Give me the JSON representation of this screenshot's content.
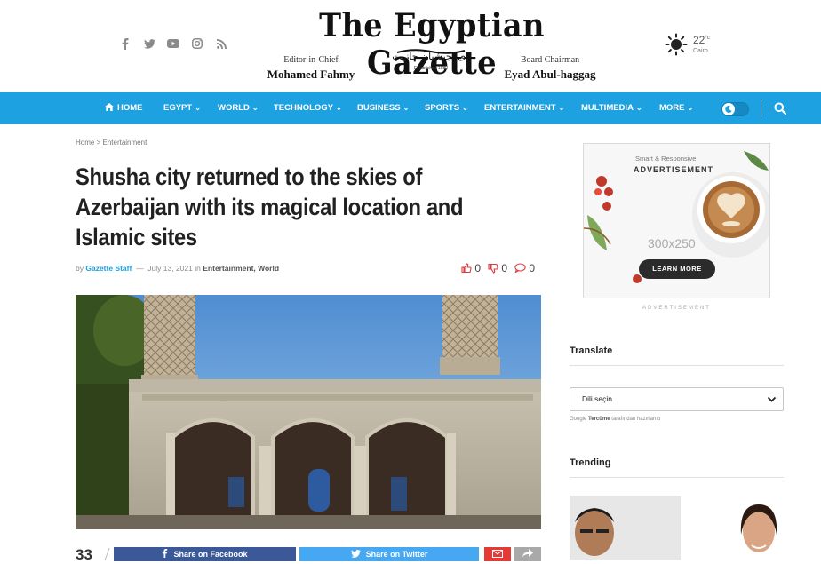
{
  "header": {
    "logo_text": "The Egyptian Gazette",
    "editor_label": "Editor-in-Chief",
    "editor_name": "Mohamed Fahmy",
    "arabic_name": "ذى اجبشيان جازيت",
    "established": "Established 1880",
    "board_label": "Board Chairman",
    "board_name": "Eyad Abul-haggag",
    "weather": {
      "temp": "22",
      "unit": "°c",
      "city": "Cairo"
    },
    "social_icons": [
      "facebook-icon",
      "twitter-icon",
      "youtube-icon",
      "instagram-icon",
      "rss-icon"
    ]
  },
  "nav": {
    "items": [
      {
        "label": "HOME",
        "has_icon": true
      },
      {
        "label": "EGYPT",
        "dropdown": true
      },
      {
        "label": "WORLD",
        "dropdown": true
      },
      {
        "label": "TECHNOLOGY",
        "dropdown": true
      },
      {
        "label": "BUSINESS",
        "dropdown": true
      },
      {
        "label": "SPORTS",
        "dropdown": true
      },
      {
        "label": "ENTERTAINMENT",
        "dropdown": true
      },
      {
        "label": "MULTIMEDIA",
        "dropdown": true
      },
      {
        "label": "MORE",
        "dropdown": true
      }
    ],
    "chevron": "⌄",
    "accent_color": "#1da1e0"
  },
  "breadcrumb": {
    "home": "Home",
    "separator": ">",
    "section": "Entertainment"
  },
  "article": {
    "title": "Shusha city returned to the skies of Azerbaijan with its magical location and Islamic sites",
    "by": "by",
    "author": "Gazette Staff",
    "dash": "—",
    "date": "July 13, 2021",
    "in": "in",
    "categories": "Entertainment, World",
    "likes": "0",
    "dislikes": "0",
    "comments": "0"
  },
  "share": {
    "count": "33",
    "facebook_label": "Share on Facebook",
    "twitter_label": "Share on Twitter",
    "facebook_color": "#3b5998",
    "twitter_color": "#46a7f2",
    "mail_color": "#e53935",
    "more_color": "#a9a9a9"
  },
  "sidebar": {
    "ad": {
      "line1": "Smart & Responsive",
      "line2": "ADVERTISEMENT",
      "size": "300x250",
      "button": "LEARN MORE",
      "caption": "ADVERTISEMENT"
    },
    "translate_heading": "Translate",
    "select_value": "Dili seçin",
    "google": "Google",
    "translate_word": "Tercüme",
    "translate_suffix": "tarafından hazırlanıb",
    "trending_heading": "Trending"
  }
}
